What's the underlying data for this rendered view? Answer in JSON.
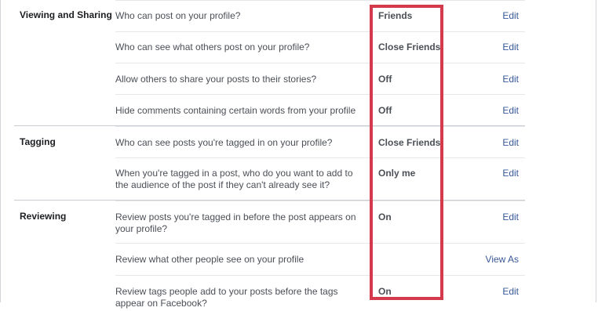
{
  "sections": [
    {
      "label": "Viewing and Sharing",
      "rows": [
        {
          "question": "Who can post on your profile?",
          "value": "Friends",
          "action": "Edit"
        },
        {
          "question": "Who can see what others post on your profile?",
          "value": "Close Friends",
          "action": "Edit"
        },
        {
          "question": "Allow others to share your posts to their stories?",
          "value": "Off",
          "action": "Edit"
        },
        {
          "question": "Hide comments containing certain words from your profile",
          "value": "Off",
          "action": "Edit"
        }
      ]
    },
    {
      "label": "Tagging",
      "rows": [
        {
          "question": "Who can see posts you're tagged in on your profile?",
          "value": "Close Friends",
          "action": "Edit"
        },
        {
          "question": "When you're tagged in a post, who do you want to add to the audience of the post if they can't already see it?",
          "value": "Only me",
          "action": "Edit"
        }
      ]
    },
    {
      "label": "Reviewing",
      "rows": [
        {
          "question": "Review posts you're tagged in before the post appears on your profile?",
          "value": "On",
          "action": "Edit"
        },
        {
          "question": "Review what other people see on your profile",
          "value": "",
          "action": "View As"
        },
        {
          "question": "Review tags people add to your posts before the tags appear on Facebook?",
          "value": "On",
          "action": "Edit"
        }
      ]
    }
  ],
  "colors": {
    "highlight": "#d43a4b",
    "link": "#385898",
    "text": "#4b4f56"
  }
}
